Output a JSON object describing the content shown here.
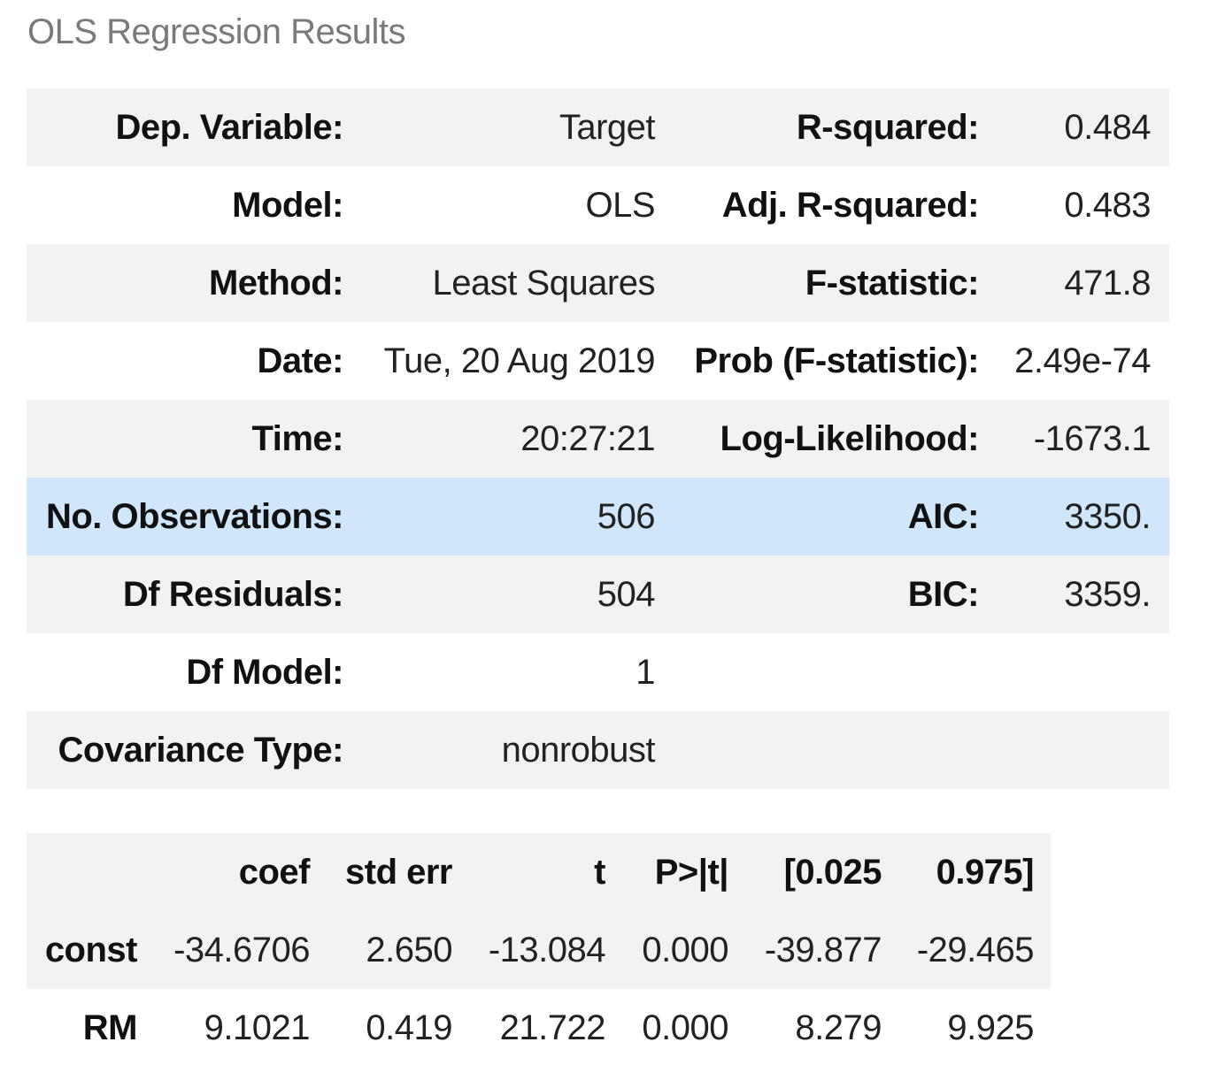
{
  "caption": "OLS Regression Results",
  "summary": {
    "rows": [
      {
        "label1": "Dep. Variable:",
        "value1": "Target",
        "label2": "R-squared:",
        "value2": "0.484"
      },
      {
        "label1": "Model:",
        "value1": "OLS",
        "label2": "Adj. R-squared:",
        "value2": "0.483"
      },
      {
        "label1": "Method:",
        "value1": "Least Squares",
        "label2": "F-statistic:",
        "value2": "471.8"
      },
      {
        "label1": "Date:",
        "value1": "Tue, 20 Aug 2019",
        "label2": "Prob (F-statistic):",
        "value2": "2.49e-74"
      },
      {
        "label1": "Time:",
        "value1": "20:27:21",
        "label2": "Log-Likelihood:",
        "value2": "-1673.1"
      },
      {
        "label1": "No. Observations:",
        "value1": "506",
        "label2": "AIC:",
        "value2": "3350."
      },
      {
        "label1": "Df Residuals:",
        "value1": "504",
        "label2": "BIC:",
        "value2": "3359."
      },
      {
        "label1": "Df Model:",
        "value1": "1",
        "label2": "",
        "value2": ""
      },
      {
        "label1": "Covariance Type:",
        "value1": "nonrobust",
        "label2": "",
        "value2": ""
      }
    ],
    "highlighted_row": "No. Observations:",
    "highlight_color": "#cfe6fb"
  },
  "coefficients": {
    "headers": [
      "",
      "coef",
      "std err",
      "t",
      "P>|t|",
      "[0.025",
      "0.975]"
    ],
    "rows": [
      [
        "const",
        "-34.6706",
        "2.650",
        "-13.084",
        "0.000",
        "-39.877",
        "-29.465"
      ],
      [
        "RM",
        "9.1021",
        "0.419",
        "21.722",
        "0.000",
        "8.279",
        "9.925"
      ]
    ]
  }
}
